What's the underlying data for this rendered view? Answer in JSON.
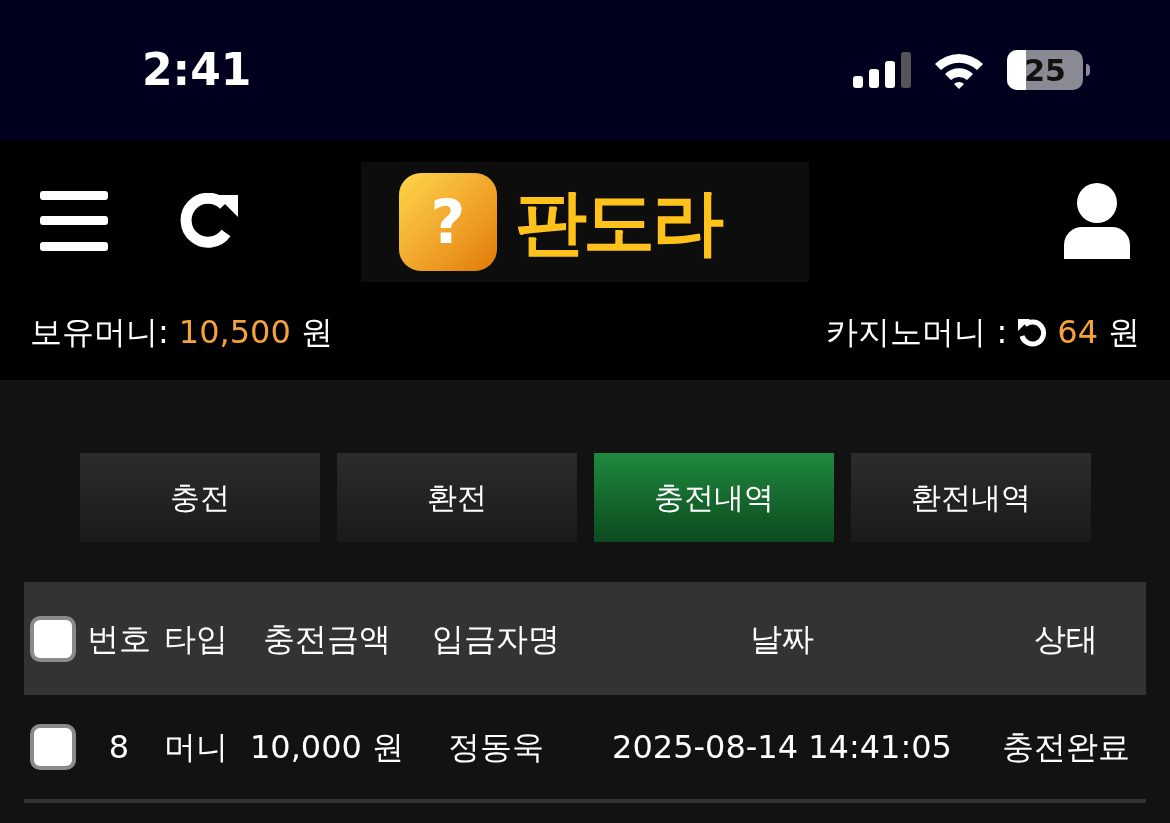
{
  "status_bar": {
    "time": "2:41",
    "battery": "25"
  },
  "header": {
    "logo_mark": "?",
    "logo_text": "판도라"
  },
  "balance": {
    "label": "보유머니:",
    "amount": "10,500",
    "unit": "원"
  },
  "casino": {
    "label": "카지노머니 :",
    "amount": "64",
    "unit": "원"
  },
  "tabs": [
    {
      "label": "충전",
      "selected": false
    },
    {
      "label": "환전",
      "selected": false
    },
    {
      "label": "충전내역",
      "selected": true
    },
    {
      "label": "환전내역",
      "selected": false
    }
  ],
  "table": {
    "select_all_checked": false,
    "columns": [
      "번호",
      "타입",
      "충전금액",
      "입금자명",
      "날짜",
      "상태"
    ],
    "rows": [
      {
        "checked": false,
        "cells": [
          "8",
          "머니",
          "10,000 원",
          "정동욱",
          "2025-08-14 14:41:05",
          "충전완료"
        ]
      }
    ]
  }
}
